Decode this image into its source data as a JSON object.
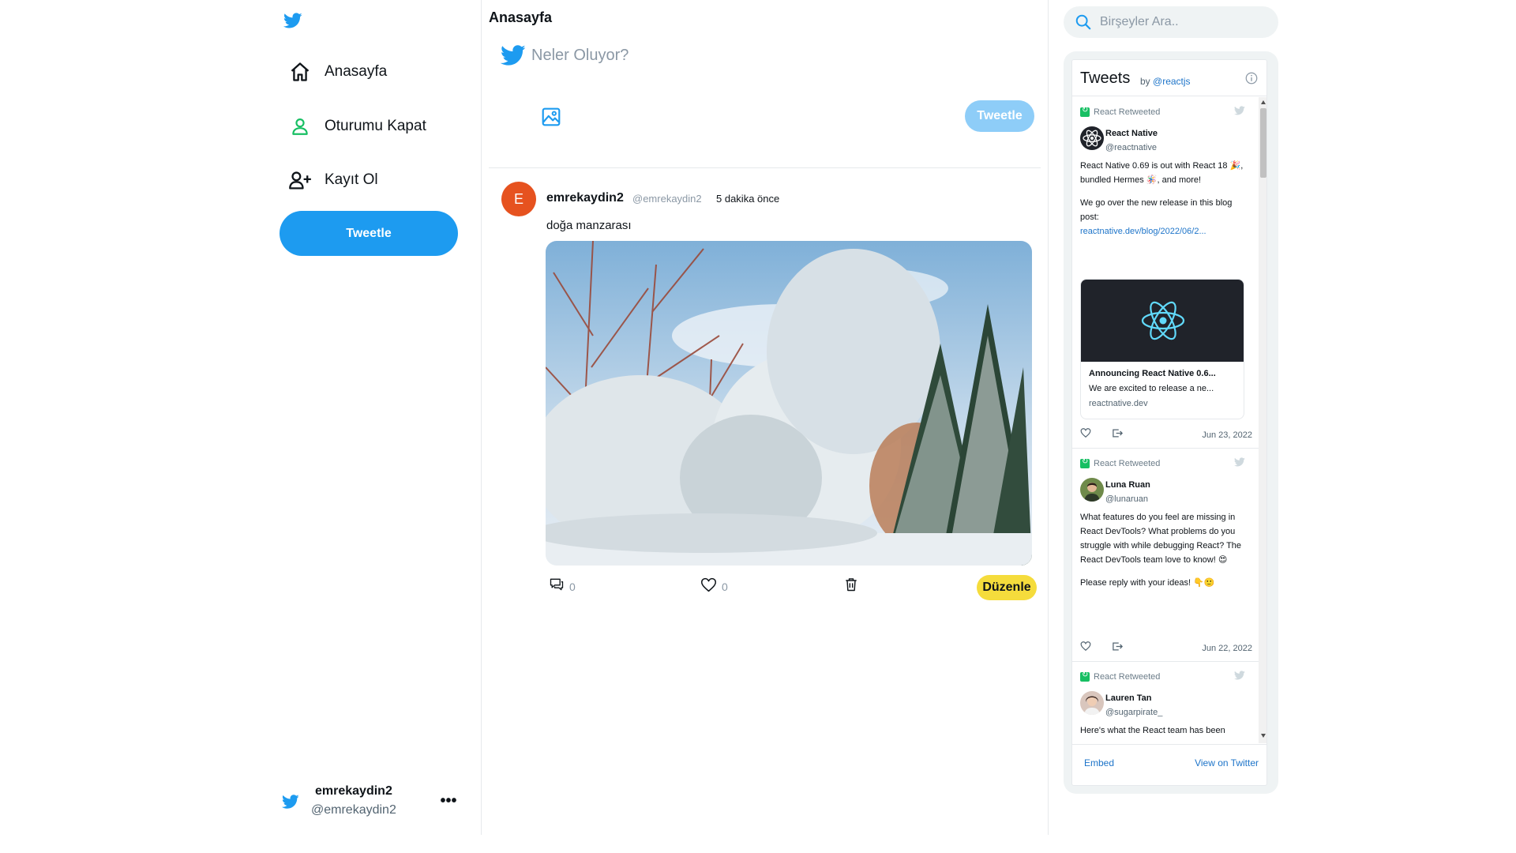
{
  "colors": {
    "accent": "#1d9bf0",
    "accent_light": "#8ecdf8",
    "edit_yellow": "#f5dc3c",
    "avatar_orange": "#e6521f",
    "link_blue": "#1d74c9",
    "retweet_green": "#17bf63"
  },
  "sidebar": {
    "logo_icon": "twitter-bird-icon",
    "items": [
      {
        "label": "Anasayfa",
        "icon": "home-icon"
      },
      {
        "label": "Oturumu Kapat",
        "icon": "user-icon"
      },
      {
        "label": "Kayıt Ol",
        "icon": "user-plus-icon"
      }
    ],
    "tweet_button": "Tweetle",
    "account": {
      "name": "emrekaydin2",
      "handle": "@emrekaydin2",
      "more": "•••"
    }
  },
  "main": {
    "title": "Anasayfa",
    "compose": {
      "placeholder": "Neler Oluyor?",
      "submit": "Tweetle",
      "image_icon": "image-icon"
    },
    "post": {
      "avatar_letter": "E",
      "name": "emrekaydin2",
      "handle": "@emrekaydin2",
      "time": "5 dakika önce",
      "text": "doğa manzarası",
      "image_alt": "snowy forest landscape",
      "comments": "0",
      "likes": "0",
      "edit_label": "Düzenle"
    }
  },
  "search": {
    "placeholder": "Birşeyler Ara.."
  },
  "widget": {
    "title": "Tweets",
    "by": "by",
    "by_handle": "@reactjs",
    "embed": "Embed",
    "view": "View on Twitter",
    "tweets": [
      {
        "retweeted": "React Retweeted",
        "name": "React Native",
        "handle": "@reactnative",
        "body": [
          "React Native 0.69 is out with React 18 🎉, bundled Hermes 🪅, and more!",
          "",
          "We go over the new release in this blog post:"
        ],
        "link": "reactnative.dev/blog/2022/06/2...",
        "card": {
          "title": "Announcing React Native 0.6...",
          "desc": "We are excited to release a ne...",
          "domain": "reactnative.dev"
        },
        "date": "Jun 23, 2022"
      },
      {
        "retweeted": "React Retweeted",
        "name": "Luna Ruan",
        "handle": "@lunaruan",
        "body": [
          "What features do you feel are missing in React DevTools? What problems do you struggle with while debugging React? The React DevTools team love to know! 😍",
          "",
          "Please reply with your ideas! 👇🙂"
        ],
        "date": "Jun 22, 2022"
      },
      {
        "retweeted": "React Retweeted",
        "name": "Lauren Tan",
        "handle": "@sugarpirate_",
        "body": [
          "Here's what the React team has been"
        ]
      }
    ]
  }
}
